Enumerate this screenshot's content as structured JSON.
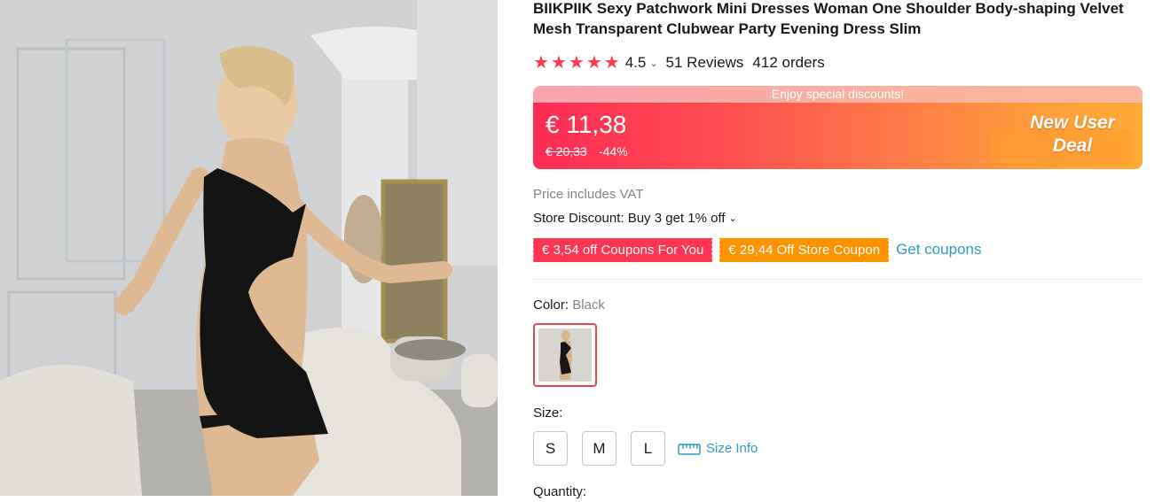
{
  "product": {
    "title": "BIIKPIIK Sexy Patchwork Mini Dresses Woman One Shoulder Body-shaping Velvet Mesh Transparent Clubwear Party Evening Dress Slim",
    "rating": "4.5",
    "rating_stars": 5,
    "reviews": "51 Reviews",
    "orders": "412 orders"
  },
  "price": {
    "banner_top": "Enjoy special discounts!",
    "current": "€ 11,38",
    "original": "€ 20,33",
    "discount": "-44%",
    "deal_line1": "New User",
    "deal_line2": "Deal",
    "vat_note": "Price includes VAT",
    "store_discount": "Store Discount: Buy 3 get 1% off"
  },
  "coupons": {
    "coupon1": "€ 3,54 off Coupons For You",
    "coupon2": "€ 29,44 Off Store Coupon",
    "get_coupons": "Get coupons"
  },
  "color": {
    "label": "Color:",
    "selected": "Black"
  },
  "size": {
    "label": "Size:",
    "options": [
      "S",
      "M",
      "L"
    ],
    "size_info": "Size Info"
  },
  "quantity": {
    "label": "Quantity:"
  },
  "icons": {
    "star": "star-icon",
    "chevron": "chevron-down-icon",
    "ruler": "ruler-icon"
  },
  "colors": {
    "accent_red": "#fd384f",
    "link_blue": "#2e9cc3",
    "coupon_red": "#fe3552",
    "coupon_orange": "#fe9300"
  }
}
